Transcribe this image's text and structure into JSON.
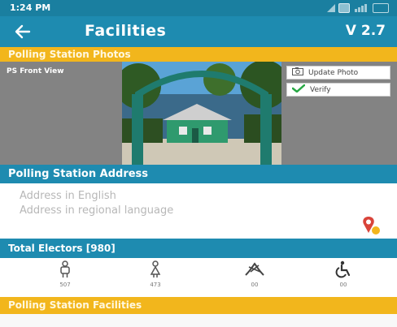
{
  "status_bar": {
    "time": "1:24 PM"
  },
  "app_bar": {
    "back_icon": "back-arrow-icon",
    "title": "Facilities",
    "version": "V 2.7"
  },
  "photos_section": {
    "header": "Polling Station Photos",
    "front_view_label": "PS Front View",
    "update_photo_label": "Update Photo",
    "verify_label": "Verify"
  },
  "address_section": {
    "header": "Polling Station Address",
    "english_placeholder": "Address in English",
    "regional_placeholder": "Address in regional language",
    "map_icon": "map-pin-icon"
  },
  "electors_section": {
    "header": "Total Electors [980]",
    "items": [
      {
        "icon": "male-icon",
        "count": "507"
      },
      {
        "icon": "female-icon",
        "count": "473"
      },
      {
        "icon": "third-gender-icon",
        "count": "00"
      },
      {
        "icon": "wheelchair-icon",
        "count": "00"
      }
    ]
  },
  "facilities_section": {
    "header": "Polling Station Facilities"
  },
  "colors": {
    "primary": "#1e8bb0",
    "accent": "#f2b61c",
    "verify": "#27a844",
    "map_pin": "#d9443a"
  }
}
